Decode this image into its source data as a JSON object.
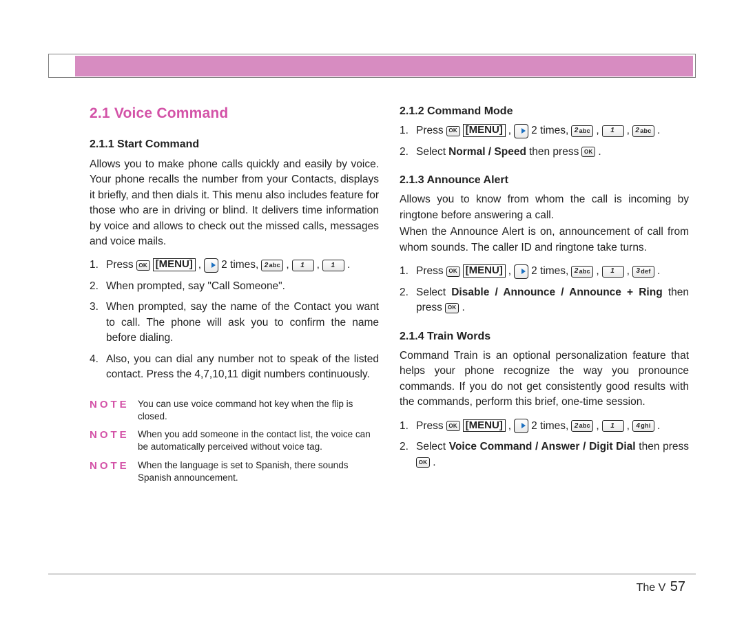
{
  "section": {
    "number": "2.1",
    "title": "Voice Command"
  },
  "left": {
    "h211": "2.1.1 Start Command",
    "p_intro": "Allows you to make phone calls quickly and easily by voice. Your phone recalls the number from your Contacts, displays it briefly, and then dials it. This menu also includes feature for those who are in driving or blind. It delivers time information by voice and allows to check out the missed calls, messages and voice mails.",
    "steps": {
      "s1_num": "1.",
      "s1_press": "Press ",
      "s1_menu": "[MENU]",
      "s1_comma": ", ",
      "s1_times": " 2 times, ",
      "s1_sep1": " , ",
      "s1_sep2": " , ",
      "s1_end": " .",
      "s2_num": "2.",
      "s2_text": "When prompted, say \"Call Someone\".",
      "s3_num": "3.",
      "s3_text": "When prompted, say the name of the Contact you want to call. The phone will ask you to confirm the name before dialing.",
      "s4_num": "4.",
      "s4_text": "Also, you can dial any number not to speak of the listed contact. Press the 4,7,10,11 digit numbers continuously."
    },
    "notes": {
      "label": "NOTE",
      "n1": "You can use voice command hot key when the flip is closed.",
      "n2": "When you add someone in the contact list, the voice can be automatically perceived without voice tag.",
      "n3": "When the language is set to Spanish, there sounds  Spanish announcement."
    },
    "keys": {
      "ok": "OK",
      "k2abc_big": "2",
      "k2abc_sub": "abc",
      "k1_big": "1"
    }
  },
  "right": {
    "h212": "2.1.2 Command Mode",
    "cm_s1_num": "1.",
    "cm_s1_press": "Press ",
    "cm_s1_menu": "[MENU]",
    "cm_s1_comma": ", ",
    "cm_s1_times": " 2 times, ",
    "cm_s1_sep1": " , ",
    "cm_s1_sep2": " , ",
    "cm_s1_end": " .",
    "cm_s2_num": "2.",
    "cm_s2_a": "Select ",
    "cm_s2_bold": "Normal / Speed",
    "cm_s2_b": " then press ",
    "cm_s2_end": " .",
    "h213": "2.1.3 Announce Alert",
    "aa_p1": "Allows you to know from whom the call is incoming by ringtone before answering a call.",
    "aa_p2": "When the Announce Alert is on, announcement of call from whom sounds. The caller ID and ringtone take turns.",
    "aa_s1_num": "1.",
    "aa_s1_press": "Press ",
    "aa_s1_menu": "[MENU]",
    "aa_s1_comma": ", ",
    "aa_s1_times": " 2 times, ",
    "aa_s1_sep1": " , ",
    "aa_s1_sep2": " , ",
    "aa_s1_end": " .",
    "aa_s2_num": "2.",
    "aa_s2_a": "Select ",
    "aa_s2_bold": "Disable / Announce / Announce + Ring",
    "aa_s2_b": " then press ",
    "aa_s2_end": " .",
    "h214": "2.1.4 Train Words",
    "tw_p": "Command Train is an optional personalization feature that helps your phone recognize the way you pronounce commands. If you do not get consistently good results with the commands, perform this brief, one-time session.",
    "tw_s1_num": "1.",
    "tw_s1_press": "Press ",
    "tw_s1_menu": "[MENU]",
    "tw_s1_comma": ", ",
    "tw_s1_times": " 2 times, ",
    "tw_s1_sep1": " , ",
    "tw_s1_sep2": " , ",
    "tw_s1_end": " .",
    "tw_s2_num": "2.",
    "tw_s2_a": "Select ",
    "tw_s2_bold": "Voice Command / Answer / Digit Dial",
    "tw_s2_b": " then press ",
    "tw_s2_end": " .",
    "keys": {
      "ok": "OK",
      "k2abc_big": "2",
      "k2abc_sub": "abc",
      "k1_big": "1",
      "k3def_big": "3",
      "k3def_sub": "def",
      "k4ghi_big": "4",
      "k4ghi_sub": "ghi"
    }
  },
  "footer": {
    "label": "The V",
    "page": "57"
  }
}
